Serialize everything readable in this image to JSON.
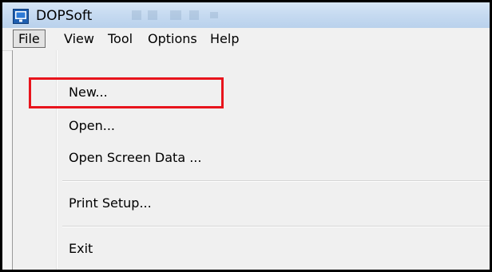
{
  "window": {
    "title": "DOPSoft",
    "icon": "app-window-icon"
  },
  "menubar": {
    "items": [
      {
        "label": "File",
        "active": true
      },
      {
        "label": "View",
        "active": false
      },
      {
        "label": "Tool",
        "active": false
      },
      {
        "label": "Options",
        "active": false
      },
      {
        "label": "Help",
        "active": false
      }
    ]
  },
  "file_menu": {
    "items": [
      {
        "label": "New..."
      },
      {
        "label": "Open..."
      },
      {
        "label": "Open Screen Data ..."
      },
      {
        "label": "Print Setup..."
      },
      {
        "label": "Exit"
      }
    ]
  },
  "colors": {
    "highlight_box": "#e8141c",
    "titlebar": "#c7dbf1",
    "menu_background": "#f0f0f0"
  }
}
